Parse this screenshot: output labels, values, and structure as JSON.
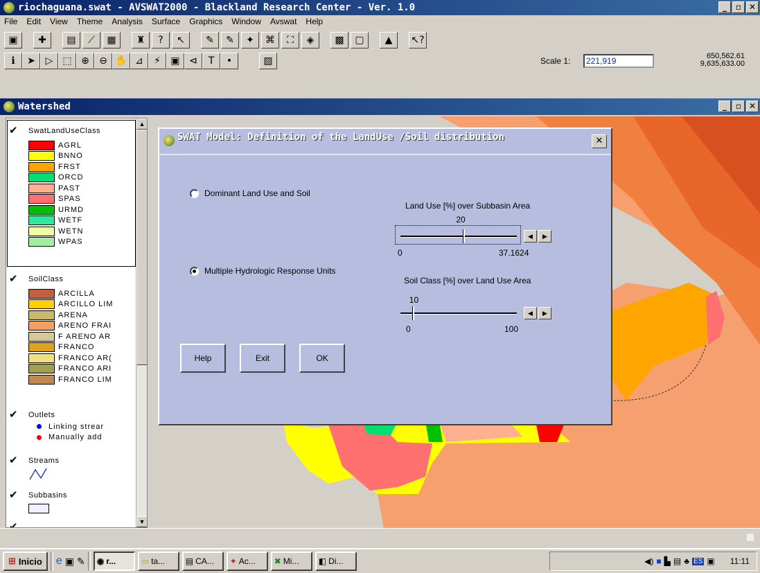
{
  "window": {
    "title": "riochaguana.swat - AVSWAT2000 - Blackland Research Center - Ver. 1.0"
  },
  "menu": [
    "File",
    "Edit",
    "View",
    "Theme",
    "Analysis",
    "Surface",
    "Graphics",
    "Window",
    "Avswat",
    "Help"
  ],
  "scale": {
    "label": "Scale 1:",
    "value": "221,919"
  },
  "coords": {
    "x": "650,562.61",
    "y": "9,635,633.00"
  },
  "view": {
    "title": "Watershed"
  },
  "legend": {
    "landuse_title": "SwatLandUseClass",
    "landuse": [
      {
        "label": "AGRL",
        "color": "#ff0000"
      },
      {
        "label": "BNNO",
        "color": "#ffff00"
      },
      {
        "label": "FRST",
        "color": "#ffa500"
      },
      {
        "label": "ORCD",
        "color": "#00e070"
      },
      {
        "label": "PAST",
        "color": "#ffb090"
      },
      {
        "label": "SPAS",
        "color": "#ff7070"
      },
      {
        "label": "URMD",
        "color": "#00c000"
      },
      {
        "label": "WETF",
        "color": "#30e8a0"
      },
      {
        "label": "WETN",
        "color": "#f0ffa0"
      },
      {
        "label": "WPAS",
        "color": "#a0f0a0"
      }
    ],
    "soil_title": "SoilClass",
    "soil": [
      {
        "label": "ARCILLA",
        "color": "#c06040"
      },
      {
        "label": "ARCILLO LIM",
        "color": "#ffd000"
      },
      {
        "label": "ARENA",
        "color": "#c8b870"
      },
      {
        "label": "ARENO FRAI",
        "color": "#f0a060"
      },
      {
        "label": "F ARENO AR",
        "color": "#d8c898"
      },
      {
        "label": "FRANCO",
        "color": "#e0a020"
      },
      {
        "label": "FRANCO AR(",
        "color": "#f0e080"
      },
      {
        "label": "FRANCO ARI",
        "color": "#a0a050"
      },
      {
        "label": "FRANCO LIM",
        "color": "#c08850"
      }
    ],
    "outlets_title": "Outlets",
    "outlets": [
      {
        "label": "Linking strear",
        "color": "#0000ff"
      },
      {
        "label": "Manually add",
        "color": "#ff0000"
      }
    ],
    "streams_title": "Streams",
    "subbasins_title": "Subbasins"
  },
  "dialog": {
    "title": "SWAT Model:  Definition of the LandUse /Soil distribution",
    "opt_dominant": "Dominant Land Use and Soil",
    "opt_multiple": "Multiple Hydrologic Response Units",
    "selected": "multiple",
    "landuse_label": "Land Use [%] over Subbasin Area",
    "landuse_value": "20",
    "landuse_min": "0",
    "landuse_max": "37.1624",
    "landuse_fraction": 0.538,
    "soil_label": "Soil Class [%] over Land Use Area",
    "soil_value": "10",
    "soil_min": "0",
    "soil_max": "100",
    "soil_fraction": 0.1,
    "help": "Help",
    "exit": "Exit",
    "ok": "OK"
  },
  "taskbar": {
    "start": "Inicio",
    "tasks": [
      "r...",
      "ta...",
      "CA...",
      "Ac...",
      "Mi...",
      "Di..."
    ],
    "lang": "ES",
    "time": "11:11"
  }
}
